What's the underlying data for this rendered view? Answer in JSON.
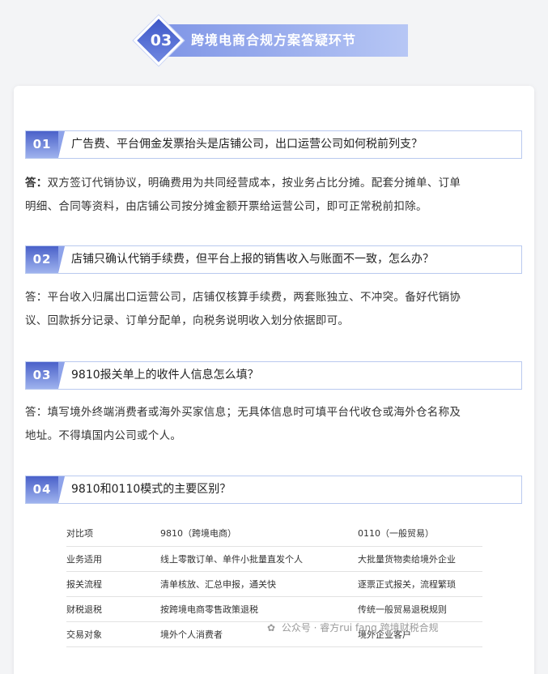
{
  "banner": {
    "number": "03",
    "title": "跨境电商合规方案答疑环节"
  },
  "questions": [
    {
      "number": "01",
      "question": "广告费、平台佣金发票抬头是店铺公司，出口运营公司如何税前列支？",
      "answer_prefix": "答：",
      "answer_line1": "双方签订代销协议，明确费用为共同经营成本，按业务占比分摊。配套分摊单、订单",
      "answer_line2": "明细、合同等资料，由店铺公司按分摊金额开票给运营公司，即可正常税前扣除。"
    },
    {
      "number": "02",
      "question": "店铺只确认代销手续费，但平台上报的销售收入与账面不一致，怎么办？",
      "answer_line1": "答：平台收入归属出口运营公司，店铺仅核算手续费，两套账独立、不冲突。备好代销协",
      "answer_line2": "议、回款拆分记录、订单分配单，向税务说明收入划分依据即可。"
    },
    {
      "number": "03",
      "question": "9810报关单上的收件人信息怎么填？",
      "answer_line1": "答：填写境外终端消费者或海外买家信息；无具体信息时可填平台代收仓或海外仓名称及",
      "answer_line2": "地址。不得填国内公司或个人。"
    },
    {
      "number": "04",
      "question": "9810和0110模式的主要区别？"
    }
  ],
  "comparison_table": {
    "rows": [
      [
        "对比项",
        "9810（跨境电商）",
        "0110（一般贸易）"
      ],
      [
        "业务适用",
        "线上零散订单、单件小批量直发个人",
        "大批量货物卖给境外企业"
      ],
      [
        "报关流程",
        "清单核放、汇总申报，通关快",
        "逐票正式报关，流程繁琐"
      ],
      [
        "财税退税",
        "按跨境电商零售政策退税",
        "传统一般贸易退税规则"
      ],
      [
        "交易对象",
        "境外个人消费者",
        "境外企业客户"
      ]
    ]
  },
  "watermark": {
    "text": "公众号 · 睿方rui fang 跨境财税合规"
  }
}
